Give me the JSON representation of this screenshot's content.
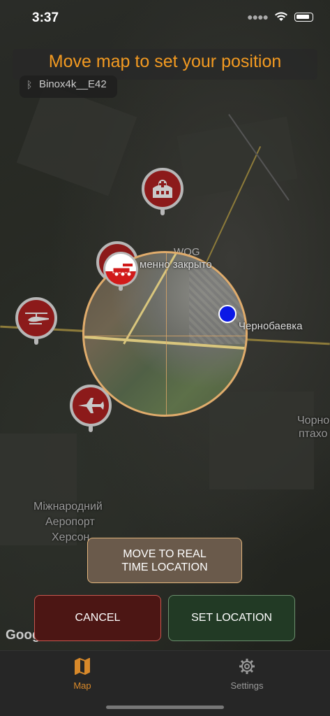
{
  "status_bar": {
    "time": "3:37"
  },
  "banner": {
    "title": "Move map to set your position"
  },
  "device": {
    "name": "Binox4k__E42"
  },
  "map": {
    "labels": {
      "wog": "WOG",
      "closed": "менно закрыто",
      "chernobaevka": "Чернобаевка",
      "right_edge_1": "Чорно",
      "right_edge_2": "птахо",
      "airport_1": "Міжнародний",
      "airport_2": "Аеропорт",
      "airport_3": "Херсон",
      "google": "Google"
    },
    "markers": [
      "hospital-icon",
      "rocket-launcher-icon",
      "helicopter-icon",
      "fighter-jet-icon",
      "artillery-icon"
    ]
  },
  "buttons": {
    "real_time_line1": "MOVE TO REAL",
    "real_time_line2": "TIME LOCATION",
    "cancel": "CANCEL",
    "set_location": "SET LOCATION"
  },
  "tabs": [
    {
      "label": "Map",
      "active": true
    },
    {
      "label": "Settings",
      "active": false
    }
  ],
  "colors": {
    "accent": "#f39a21",
    "marker_red": "#8c1a1a",
    "location_blue": "#0a18e6"
  }
}
